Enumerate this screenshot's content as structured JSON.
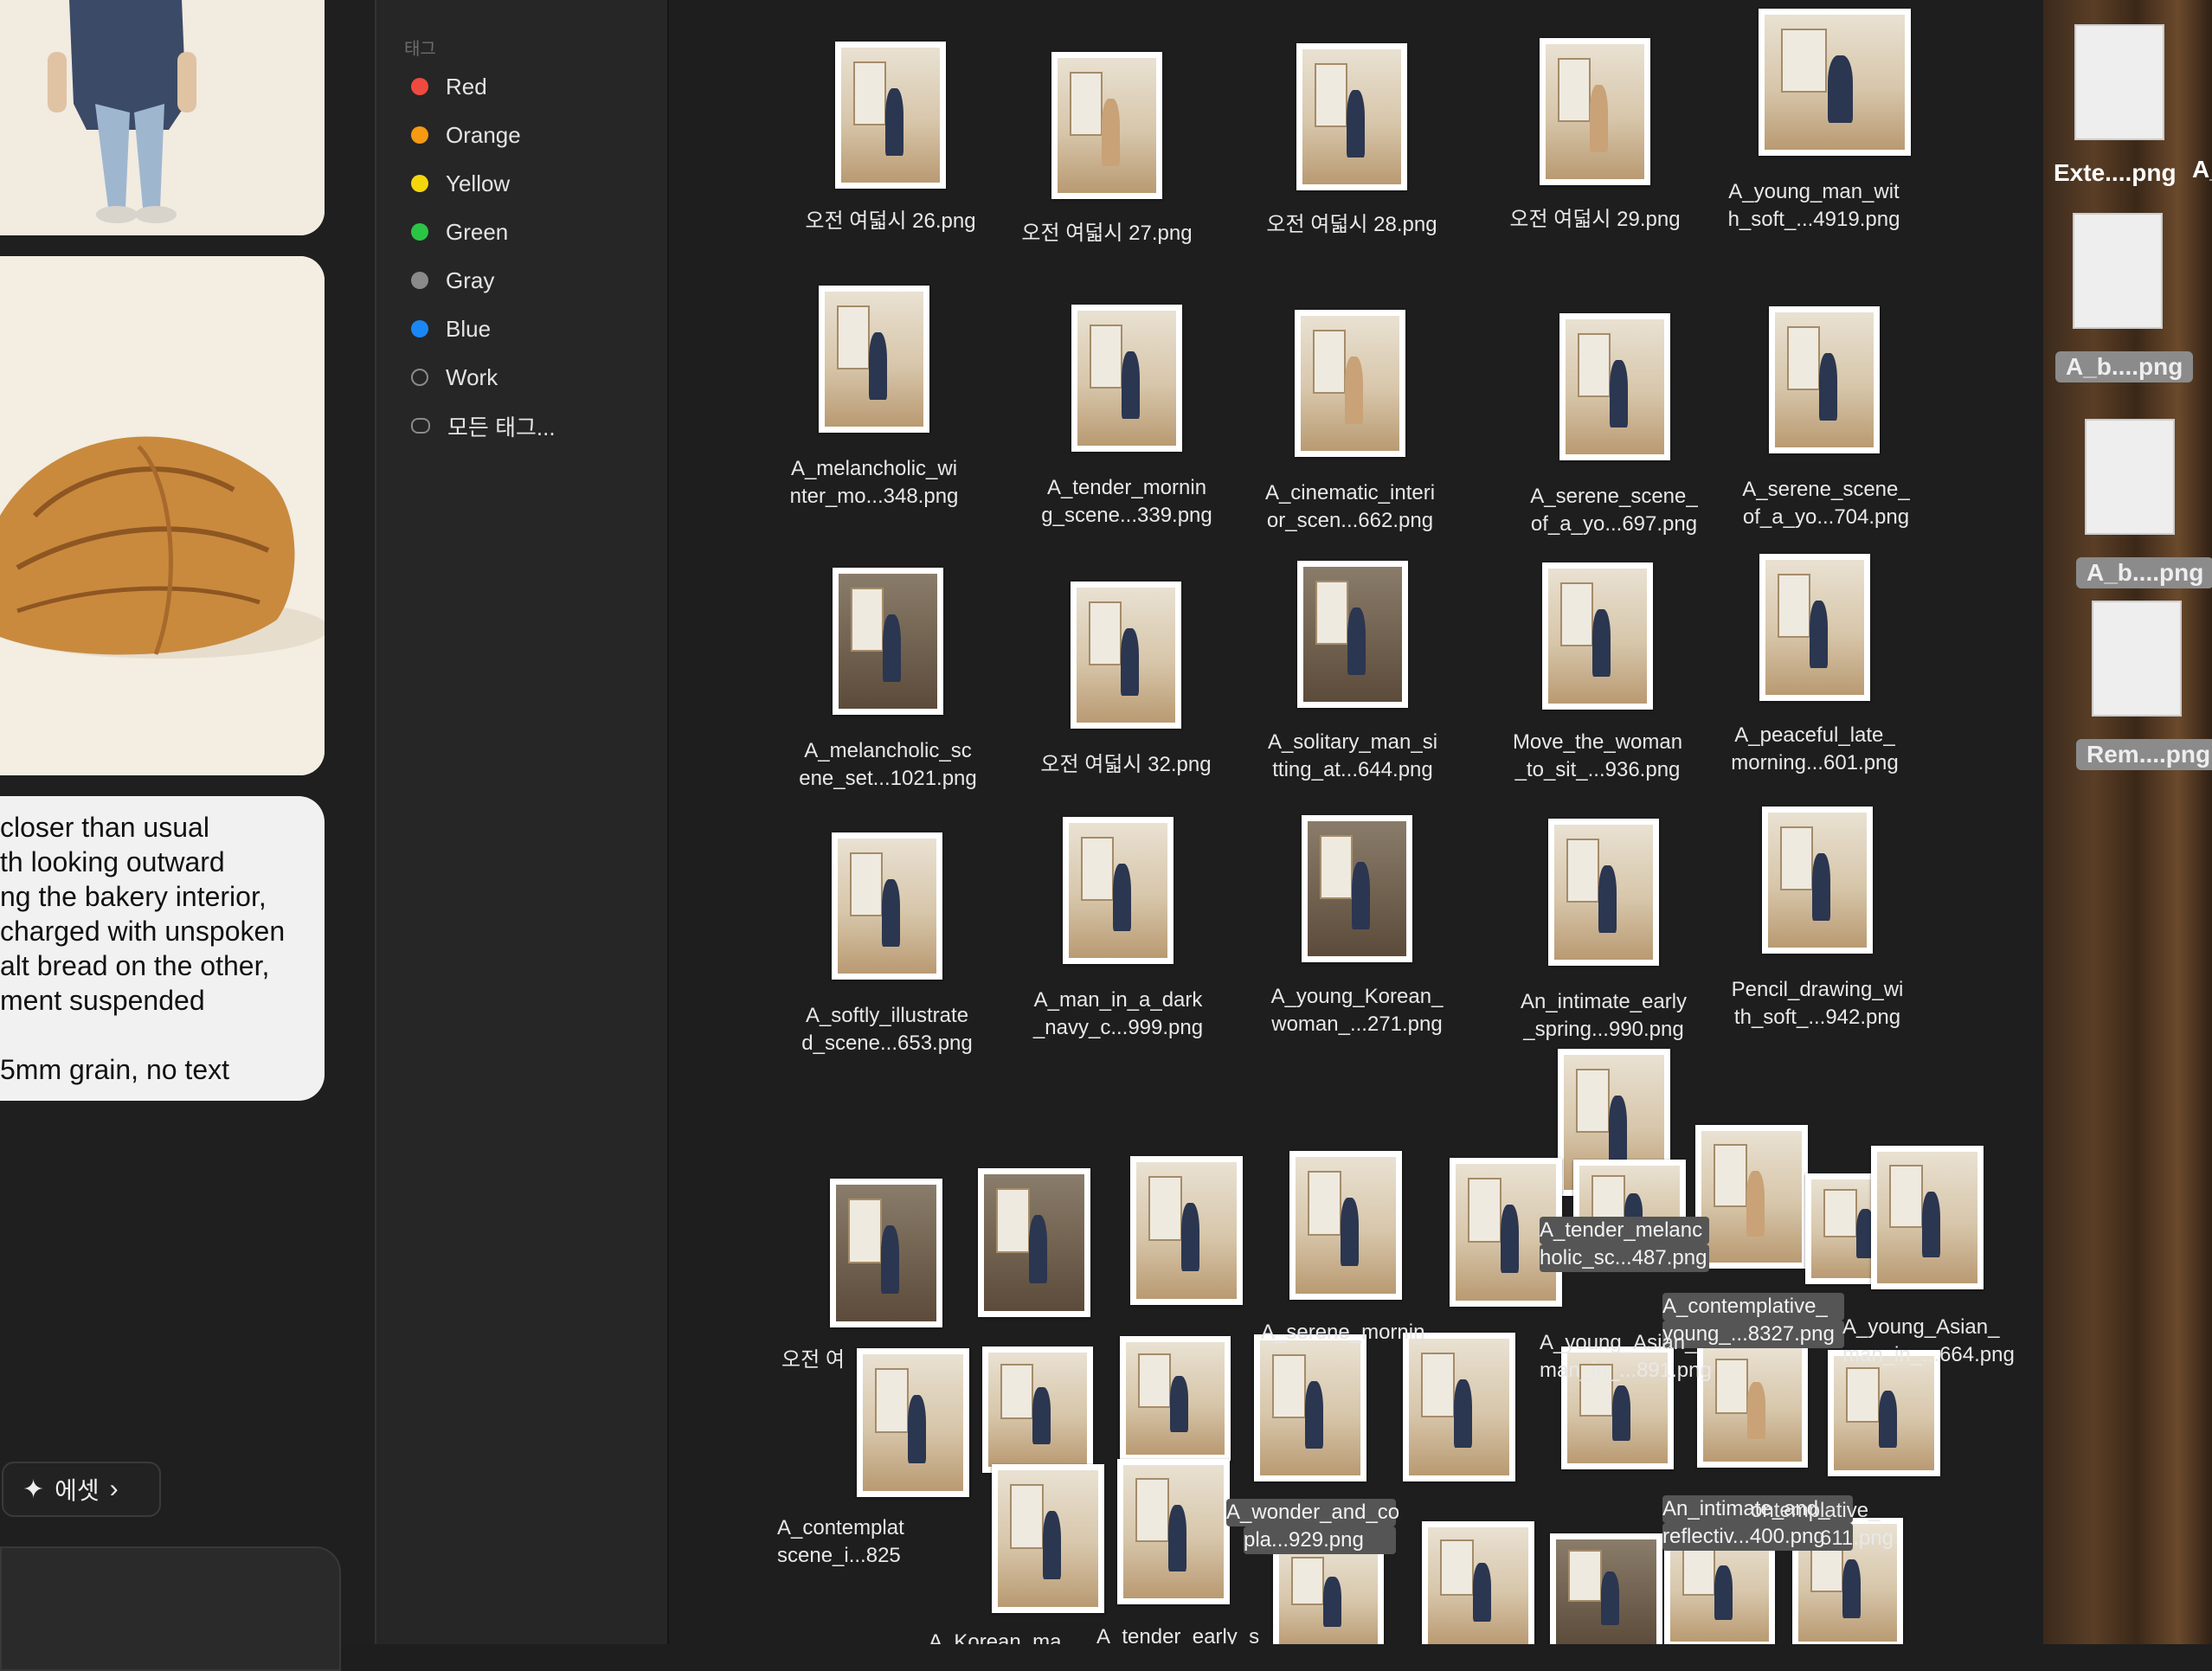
{
  "chat": {
    "bubble_lines": [
      "closer than usual",
      "th looking outward",
      "ng the bakery interior,",
      "charged with unspoken",
      "alt bread on the other,",
      "ment suspended",
      "",
      "5mm grain, no text"
    ],
    "asset_button_label": "에셋"
  },
  "tags": {
    "header": "태그",
    "items": [
      {
        "label": "Red",
        "color": "#ef4a40"
      },
      {
        "label": "Orange",
        "color": "#f59a12"
      },
      {
        "label": "Yellow",
        "color": "#f5d60c"
      },
      {
        "label": "Green",
        "color": "#2bc545"
      },
      {
        "label": "Gray",
        "color": "#8a8a8a"
      },
      {
        "label": "Blue",
        "color": "#1b87f4"
      },
      {
        "label": "Work",
        "color": "outline"
      },
      {
        "label": "모든 태그...",
        "color": "all-tags"
      }
    ]
  },
  "files": [
    {
      "line1": "오전 여덟시 26.png",
      "line2": ""
    },
    {
      "line1": "오전 여덟시 27.png",
      "line2": ""
    },
    {
      "line1": "오전 여덟시 28.png",
      "line2": ""
    },
    {
      "line1": "오전 여덟시 29.png",
      "line2": ""
    },
    {
      "line1": "A_young_man_wit",
      "line2": "h_soft_...4919.png"
    },
    {
      "line1": "A_melancholic_wi",
      "line2": "nter_mo...348.png"
    },
    {
      "line1": "A_tender_mornin",
      "line2": "g_scene...339.png"
    },
    {
      "line1": "A_cinematic_interi",
      "line2": "or_scen...662.png"
    },
    {
      "line1": "A_serene_scene_",
      "line2": "of_a_yo...697.png"
    },
    {
      "line1": "A_serene_scene_",
      "line2": "of_a_yo...704.png"
    },
    {
      "line1": "A_melancholic_sc",
      "line2": "ene_set...1021.png"
    },
    {
      "line1": "오전 여덟시 32.png",
      "line2": ""
    },
    {
      "line1": "A_solitary_man_si",
      "line2": "tting_at...644.png"
    },
    {
      "line1": "Move_the_woman",
      "line2": "_to_sit_...936.png"
    },
    {
      "line1": "A_peaceful_late_",
      "line2": "morning...601.png"
    },
    {
      "line1": "A_softly_illustrate",
      "line2": "d_scene...653.png"
    },
    {
      "line1": "A_man_in_a_dark",
      "line2": "_navy_c...999.png"
    },
    {
      "line1": "A_young_Korean_",
      "line2": "woman_...271.png"
    },
    {
      "line1": "An_intimate_early",
      "line2": "_spring...990.png"
    },
    {
      "line1": "Pencil_drawing_wi",
      "line2": "th_soft_...942.png"
    }
  ],
  "scattered_labels": [
    "A_contemplative_",
    "young_...8327.png",
    "A_young_Asian_",
    "man_in_...664.png",
    "A_young_Asian_",
    "man_in_...891.png",
    "A_contemplat",
    "scene_i...825",
    "An_intimate_and_",
    "reflectiv...400.png",
    "A_serene_mornin",
    "A_wonder_and_co",
    "pla...929.png",
    "ontemplative_",
    "611.png",
    "A_tender_melanc",
    "holic_sc...487.png",
    "A_tender_early_s",
    "A_Korean_ma",
    "오전 여"
  ],
  "dock": {
    "items": [
      {
        "label": "Exte....png",
        "style": "plain"
      },
      {
        "label": "A_b....png",
        "style": "pill"
      },
      {
        "label": "A_b....png",
        "style": "pill"
      },
      {
        "label": "Rem....png",
        "style": "pill"
      }
    ],
    "edge_label": "A_"
  }
}
